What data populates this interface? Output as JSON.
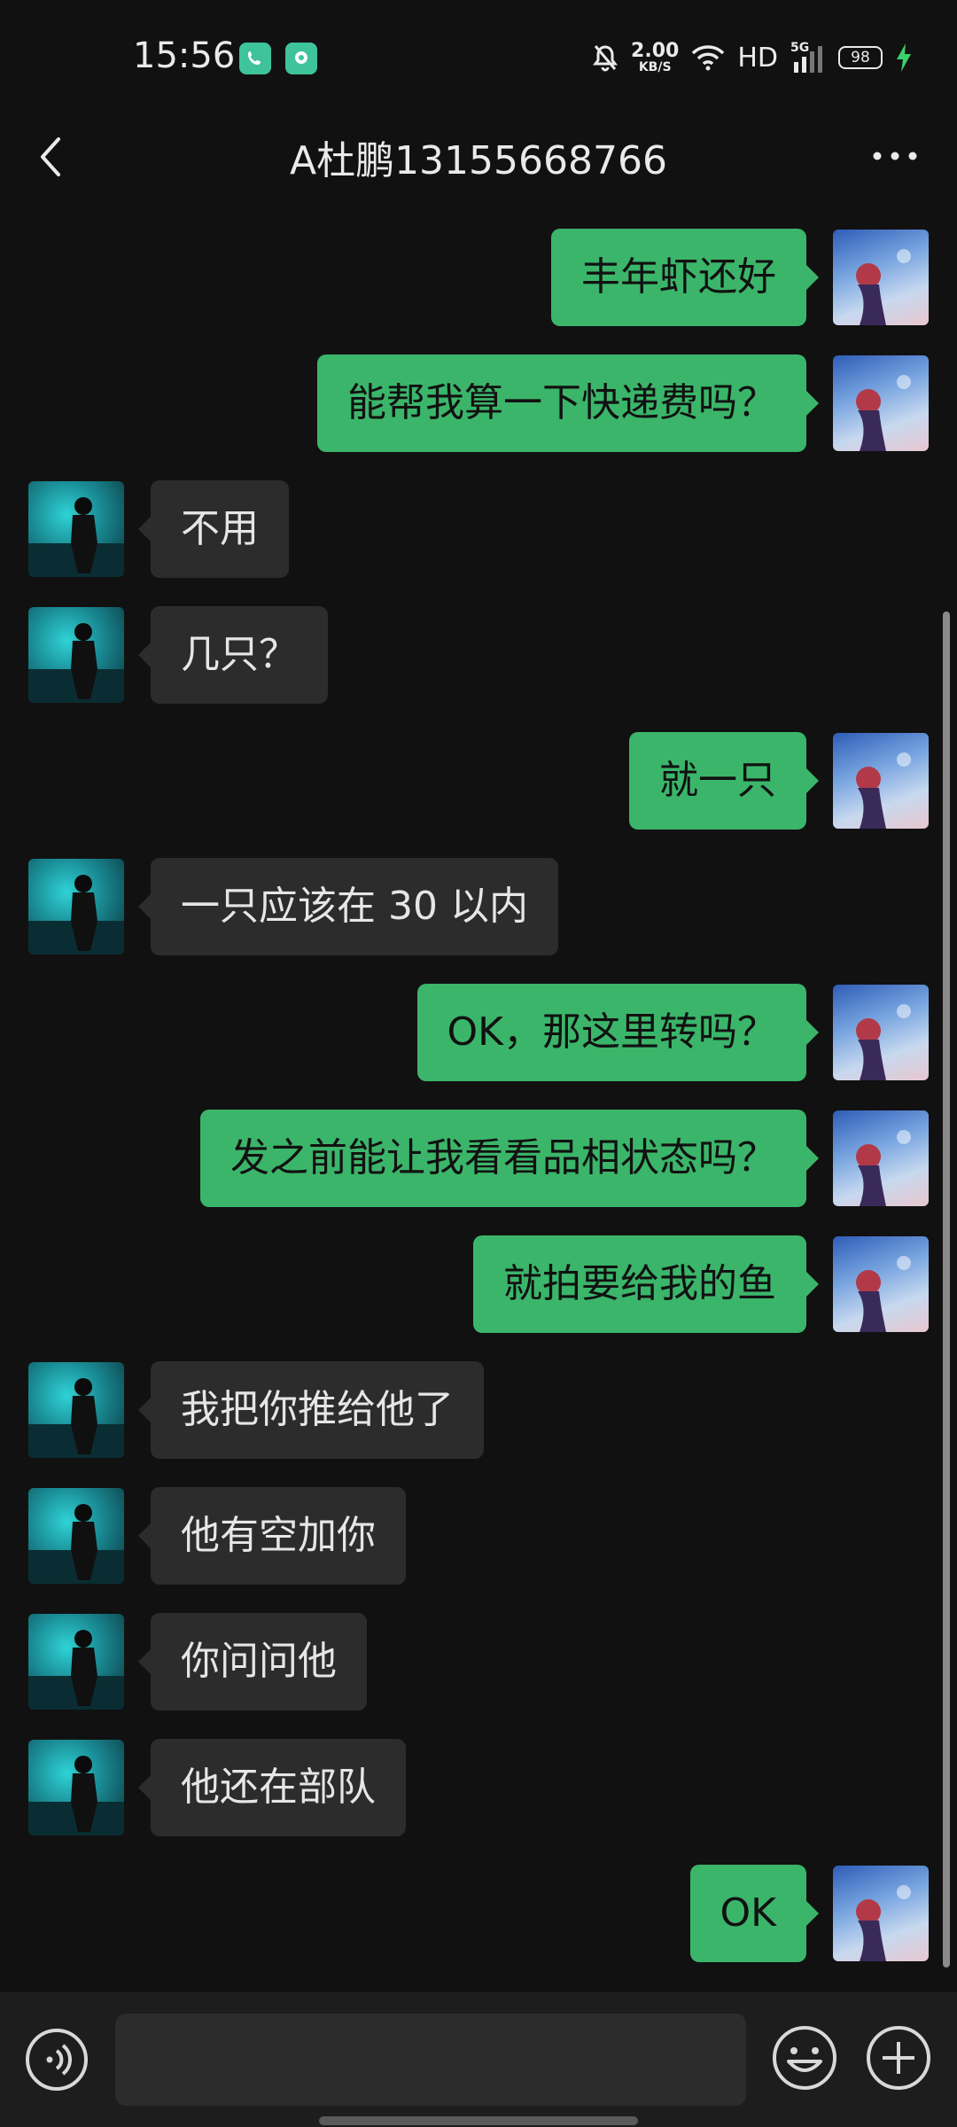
{
  "status_bar": {
    "time": "15:56",
    "net_speed_value": "2.00",
    "net_speed_unit": "KB/S",
    "network_label": "HD",
    "signal_label": "5G",
    "battery": "98"
  },
  "header": {
    "title": "A杜鹏13155668766"
  },
  "messages": [
    {
      "side": "right",
      "text": "丰年虾还好"
    },
    {
      "side": "right",
      "text": "能帮我算一下快递费吗？"
    },
    {
      "side": "left",
      "text": "不用"
    },
    {
      "side": "left",
      "text": "几只？"
    },
    {
      "side": "right",
      "text": "就一只"
    },
    {
      "side": "left",
      "text": "一只应该在 30 以内"
    },
    {
      "side": "right",
      "text": "OK，那这里转吗？"
    },
    {
      "side": "right",
      "text": "发之前能让我看看品相状态吗？"
    },
    {
      "side": "right",
      "text": "就拍要给我的鱼"
    },
    {
      "side": "left",
      "text": "我把你推给他了"
    },
    {
      "side": "left",
      "text": "他有空加你"
    },
    {
      "side": "left",
      "text": "你问问他"
    },
    {
      "side": "left",
      "text": "他还在部队"
    },
    {
      "side": "right",
      "text": "OK"
    }
  ],
  "input": {
    "value": ""
  },
  "colors": {
    "background": "#111111",
    "self_bubble": "#3bb56a",
    "friend_bubble": "#2c2c2c"
  },
  "icons": [
    "back-arrow-icon",
    "more-icon",
    "voice-icon",
    "emoji-icon",
    "plus-icon",
    "phone-app-icon",
    "chat-app-icon",
    "mute-bell-icon",
    "wifi-icon",
    "signal-icon",
    "battery-icon",
    "charging-icon"
  ]
}
